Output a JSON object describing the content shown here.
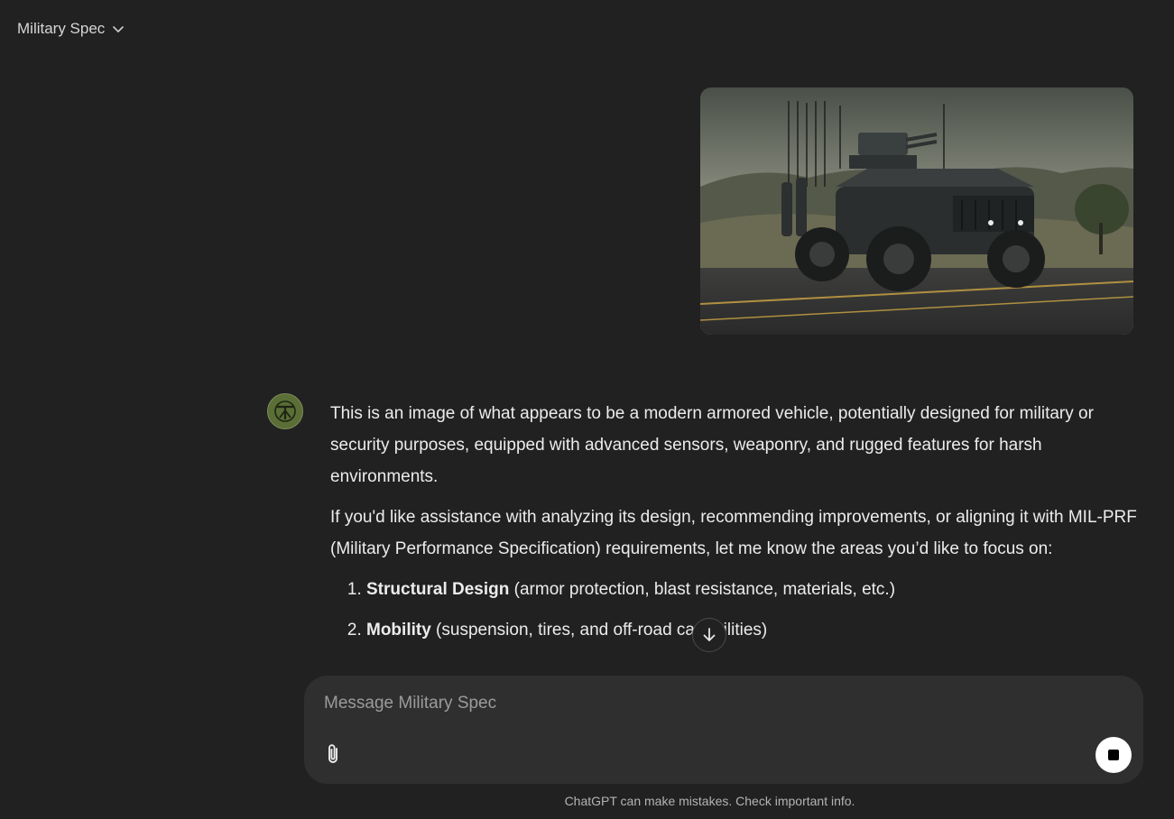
{
  "header": {
    "title": "Military Spec"
  },
  "conversation": {
    "assistant": {
      "paragraph1": "This is an image of what appears to be a modern armored vehicle, potentially designed for military or security purposes, equipped with advanced sensors, weaponry, and rugged features for harsh environments.",
      "paragraph2": "If you'd like assistance with analyzing its design, recommending improvements, or aligning it with MIL-PRF (Military Performance Specification) requirements, let me know the areas you’d like to focus on:",
      "list": [
        {
          "title": "Structural Design",
          "detail": " (armor protection, blast resistance, materials, etc.)"
        },
        {
          "title": "Mobility",
          "detail": " (suspension, tires, and off-road capabilities)"
        }
      ]
    }
  },
  "composer": {
    "placeholder": "Message Military Spec"
  },
  "footer": {
    "disclaimer": "ChatGPT can make mistakes. Check important info."
  },
  "icons": {
    "header_dropdown": "chevron-down-icon",
    "avatar": "gpt-avatar-icon",
    "scroll": "arrow-down-icon",
    "attach": "paperclip-icon",
    "stop": "stop-icon"
  }
}
